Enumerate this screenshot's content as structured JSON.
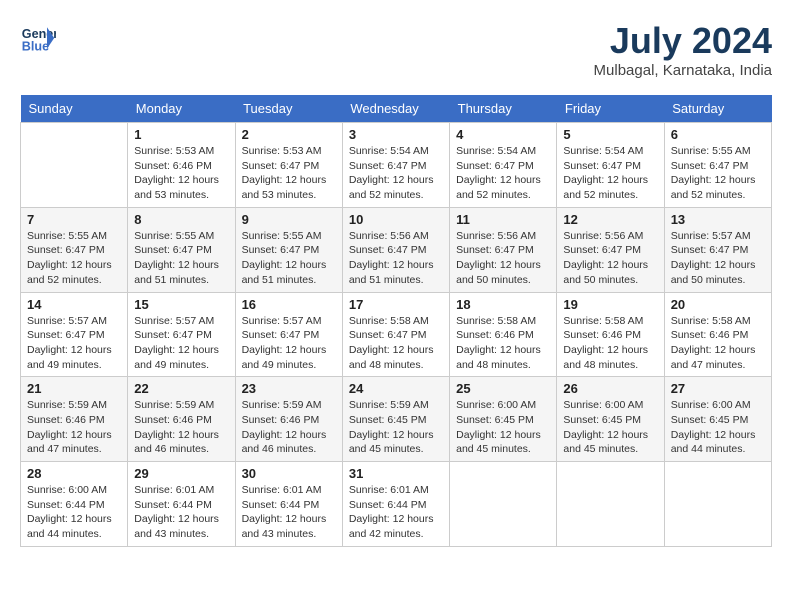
{
  "header": {
    "logo_line1": "General",
    "logo_line2": "Blue",
    "month_year": "July 2024",
    "location": "Mulbagal, Karnataka, India"
  },
  "weekdays": [
    "Sunday",
    "Monday",
    "Tuesday",
    "Wednesday",
    "Thursday",
    "Friday",
    "Saturday"
  ],
  "weeks": [
    [
      {
        "day": "",
        "sunrise": "",
        "sunset": "",
        "daylight": ""
      },
      {
        "day": "1",
        "sunrise": "Sunrise: 5:53 AM",
        "sunset": "Sunset: 6:46 PM",
        "daylight": "Daylight: 12 hours and 53 minutes."
      },
      {
        "day": "2",
        "sunrise": "Sunrise: 5:53 AM",
        "sunset": "Sunset: 6:47 PM",
        "daylight": "Daylight: 12 hours and 53 minutes."
      },
      {
        "day": "3",
        "sunrise": "Sunrise: 5:54 AM",
        "sunset": "Sunset: 6:47 PM",
        "daylight": "Daylight: 12 hours and 52 minutes."
      },
      {
        "day": "4",
        "sunrise": "Sunrise: 5:54 AM",
        "sunset": "Sunset: 6:47 PM",
        "daylight": "Daylight: 12 hours and 52 minutes."
      },
      {
        "day": "5",
        "sunrise": "Sunrise: 5:54 AM",
        "sunset": "Sunset: 6:47 PM",
        "daylight": "Daylight: 12 hours and 52 minutes."
      },
      {
        "day": "6",
        "sunrise": "Sunrise: 5:55 AM",
        "sunset": "Sunset: 6:47 PM",
        "daylight": "Daylight: 12 hours and 52 minutes."
      }
    ],
    [
      {
        "day": "7",
        "sunrise": "Sunrise: 5:55 AM",
        "sunset": "Sunset: 6:47 PM",
        "daylight": "Daylight: 12 hours and 52 minutes."
      },
      {
        "day": "8",
        "sunrise": "Sunrise: 5:55 AM",
        "sunset": "Sunset: 6:47 PM",
        "daylight": "Daylight: 12 hours and 51 minutes."
      },
      {
        "day": "9",
        "sunrise": "Sunrise: 5:55 AM",
        "sunset": "Sunset: 6:47 PM",
        "daylight": "Daylight: 12 hours and 51 minutes."
      },
      {
        "day": "10",
        "sunrise": "Sunrise: 5:56 AM",
        "sunset": "Sunset: 6:47 PM",
        "daylight": "Daylight: 12 hours and 51 minutes."
      },
      {
        "day": "11",
        "sunrise": "Sunrise: 5:56 AM",
        "sunset": "Sunset: 6:47 PM",
        "daylight": "Daylight: 12 hours and 50 minutes."
      },
      {
        "day": "12",
        "sunrise": "Sunrise: 5:56 AM",
        "sunset": "Sunset: 6:47 PM",
        "daylight": "Daylight: 12 hours and 50 minutes."
      },
      {
        "day": "13",
        "sunrise": "Sunrise: 5:57 AM",
        "sunset": "Sunset: 6:47 PM",
        "daylight": "Daylight: 12 hours and 50 minutes."
      }
    ],
    [
      {
        "day": "14",
        "sunrise": "Sunrise: 5:57 AM",
        "sunset": "Sunset: 6:47 PM",
        "daylight": "Daylight: 12 hours and 49 minutes."
      },
      {
        "day": "15",
        "sunrise": "Sunrise: 5:57 AM",
        "sunset": "Sunset: 6:47 PM",
        "daylight": "Daylight: 12 hours and 49 minutes."
      },
      {
        "day": "16",
        "sunrise": "Sunrise: 5:57 AM",
        "sunset": "Sunset: 6:47 PM",
        "daylight": "Daylight: 12 hours and 49 minutes."
      },
      {
        "day": "17",
        "sunrise": "Sunrise: 5:58 AM",
        "sunset": "Sunset: 6:47 PM",
        "daylight": "Daylight: 12 hours and 48 minutes."
      },
      {
        "day": "18",
        "sunrise": "Sunrise: 5:58 AM",
        "sunset": "Sunset: 6:46 PM",
        "daylight": "Daylight: 12 hours and 48 minutes."
      },
      {
        "day": "19",
        "sunrise": "Sunrise: 5:58 AM",
        "sunset": "Sunset: 6:46 PM",
        "daylight": "Daylight: 12 hours and 48 minutes."
      },
      {
        "day": "20",
        "sunrise": "Sunrise: 5:58 AM",
        "sunset": "Sunset: 6:46 PM",
        "daylight": "Daylight: 12 hours and 47 minutes."
      }
    ],
    [
      {
        "day": "21",
        "sunrise": "Sunrise: 5:59 AM",
        "sunset": "Sunset: 6:46 PM",
        "daylight": "Daylight: 12 hours and 47 minutes."
      },
      {
        "day": "22",
        "sunrise": "Sunrise: 5:59 AM",
        "sunset": "Sunset: 6:46 PM",
        "daylight": "Daylight: 12 hours and 46 minutes."
      },
      {
        "day": "23",
        "sunrise": "Sunrise: 5:59 AM",
        "sunset": "Sunset: 6:46 PM",
        "daylight": "Daylight: 12 hours and 46 minutes."
      },
      {
        "day": "24",
        "sunrise": "Sunrise: 5:59 AM",
        "sunset": "Sunset: 6:45 PM",
        "daylight": "Daylight: 12 hours and 45 minutes."
      },
      {
        "day": "25",
        "sunrise": "Sunrise: 6:00 AM",
        "sunset": "Sunset: 6:45 PM",
        "daylight": "Daylight: 12 hours and 45 minutes."
      },
      {
        "day": "26",
        "sunrise": "Sunrise: 6:00 AM",
        "sunset": "Sunset: 6:45 PM",
        "daylight": "Daylight: 12 hours and 45 minutes."
      },
      {
        "day": "27",
        "sunrise": "Sunrise: 6:00 AM",
        "sunset": "Sunset: 6:45 PM",
        "daylight": "Daylight: 12 hours and 44 minutes."
      }
    ],
    [
      {
        "day": "28",
        "sunrise": "Sunrise: 6:00 AM",
        "sunset": "Sunset: 6:44 PM",
        "daylight": "Daylight: 12 hours and 44 minutes."
      },
      {
        "day": "29",
        "sunrise": "Sunrise: 6:01 AM",
        "sunset": "Sunset: 6:44 PM",
        "daylight": "Daylight: 12 hours and 43 minutes."
      },
      {
        "day": "30",
        "sunrise": "Sunrise: 6:01 AM",
        "sunset": "Sunset: 6:44 PM",
        "daylight": "Daylight: 12 hours and 43 minutes."
      },
      {
        "day": "31",
        "sunrise": "Sunrise: 6:01 AM",
        "sunset": "Sunset: 6:44 PM",
        "daylight": "Daylight: 12 hours and 42 minutes."
      },
      {
        "day": "",
        "sunrise": "",
        "sunset": "",
        "daylight": ""
      },
      {
        "day": "",
        "sunrise": "",
        "sunset": "",
        "daylight": ""
      },
      {
        "day": "",
        "sunrise": "",
        "sunset": "",
        "daylight": ""
      }
    ]
  ]
}
